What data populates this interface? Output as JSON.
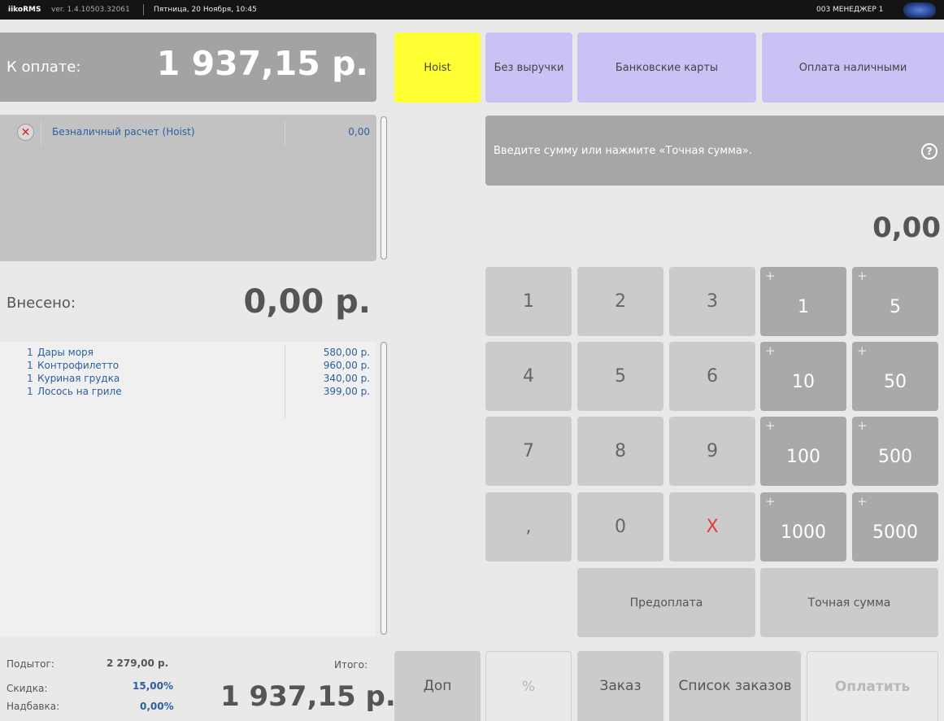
{
  "topbar": {
    "brand": "iikoRMS",
    "version": "ver. 1.4.10503.32061",
    "date": "Пятница, 20 Ноября, 10:45",
    "user": "003 МЕНЕДЖЕР 1"
  },
  "to_pay": {
    "label": "К оплате:",
    "value": "1 937,15 р."
  },
  "payments": [
    {
      "name": "Безналичный расчет (Hoist)",
      "amount": "0,00",
      "removable": true
    }
  ],
  "deposited": {
    "label": "Внесено:",
    "value": "0,00 р."
  },
  "order_items": [
    {
      "qty": "1",
      "name": "Дары моря",
      "price": "580,00 р."
    },
    {
      "qty": "1",
      "name": "Контрофилетто",
      "price": "960,00 р."
    },
    {
      "qty": "1",
      "name": "Куриная грудка",
      "price": "340,00 р."
    },
    {
      "qty": "1",
      "name": "Лосось на гриле",
      "price": "399,00 р."
    }
  ],
  "totals": {
    "subtotal_label": "Подытог:",
    "subtotal": "2 279,00 р.",
    "discount_label": "Скидка:",
    "discount": "15,00%",
    "surcharge_label": "Надбавка:",
    "surcharge": "0,00%",
    "total_label": "Итого:",
    "total": "1 937,15 р."
  },
  "payment_types": {
    "hoist": "Hoist",
    "no_revenue": "Без выручки",
    "bank_cards": "Банковские карты",
    "cash": "Оплата наличными",
    "active_color": "#ffff33",
    "color": "#c8c2f5"
  },
  "hint": {
    "text": "Введите сумму или нажмите «Точная сумма».",
    "help": "?"
  },
  "amount_display": "0,00",
  "keypad": {
    "k1": "1",
    "k2": "2",
    "k3": "3",
    "k4": "4",
    "k5": "5",
    "k6": "6",
    "k7": "7",
    "k8": "8",
    "k9": "9",
    "comma": ",",
    "k0": "0",
    "clear": "X",
    "plus": "+",
    "add1": "1",
    "add5": "5",
    "add10": "10",
    "add50": "50",
    "add100": "100",
    "add500": "500",
    "add1000": "1000",
    "add5000": "5000",
    "prepay": "Предоплата",
    "exact": "Точная сумма"
  },
  "bottom": {
    "extra": "Доп",
    "percent": "%",
    "order": "Заказ",
    "orders_list": "Список заказов",
    "pay": "Оплатить"
  }
}
